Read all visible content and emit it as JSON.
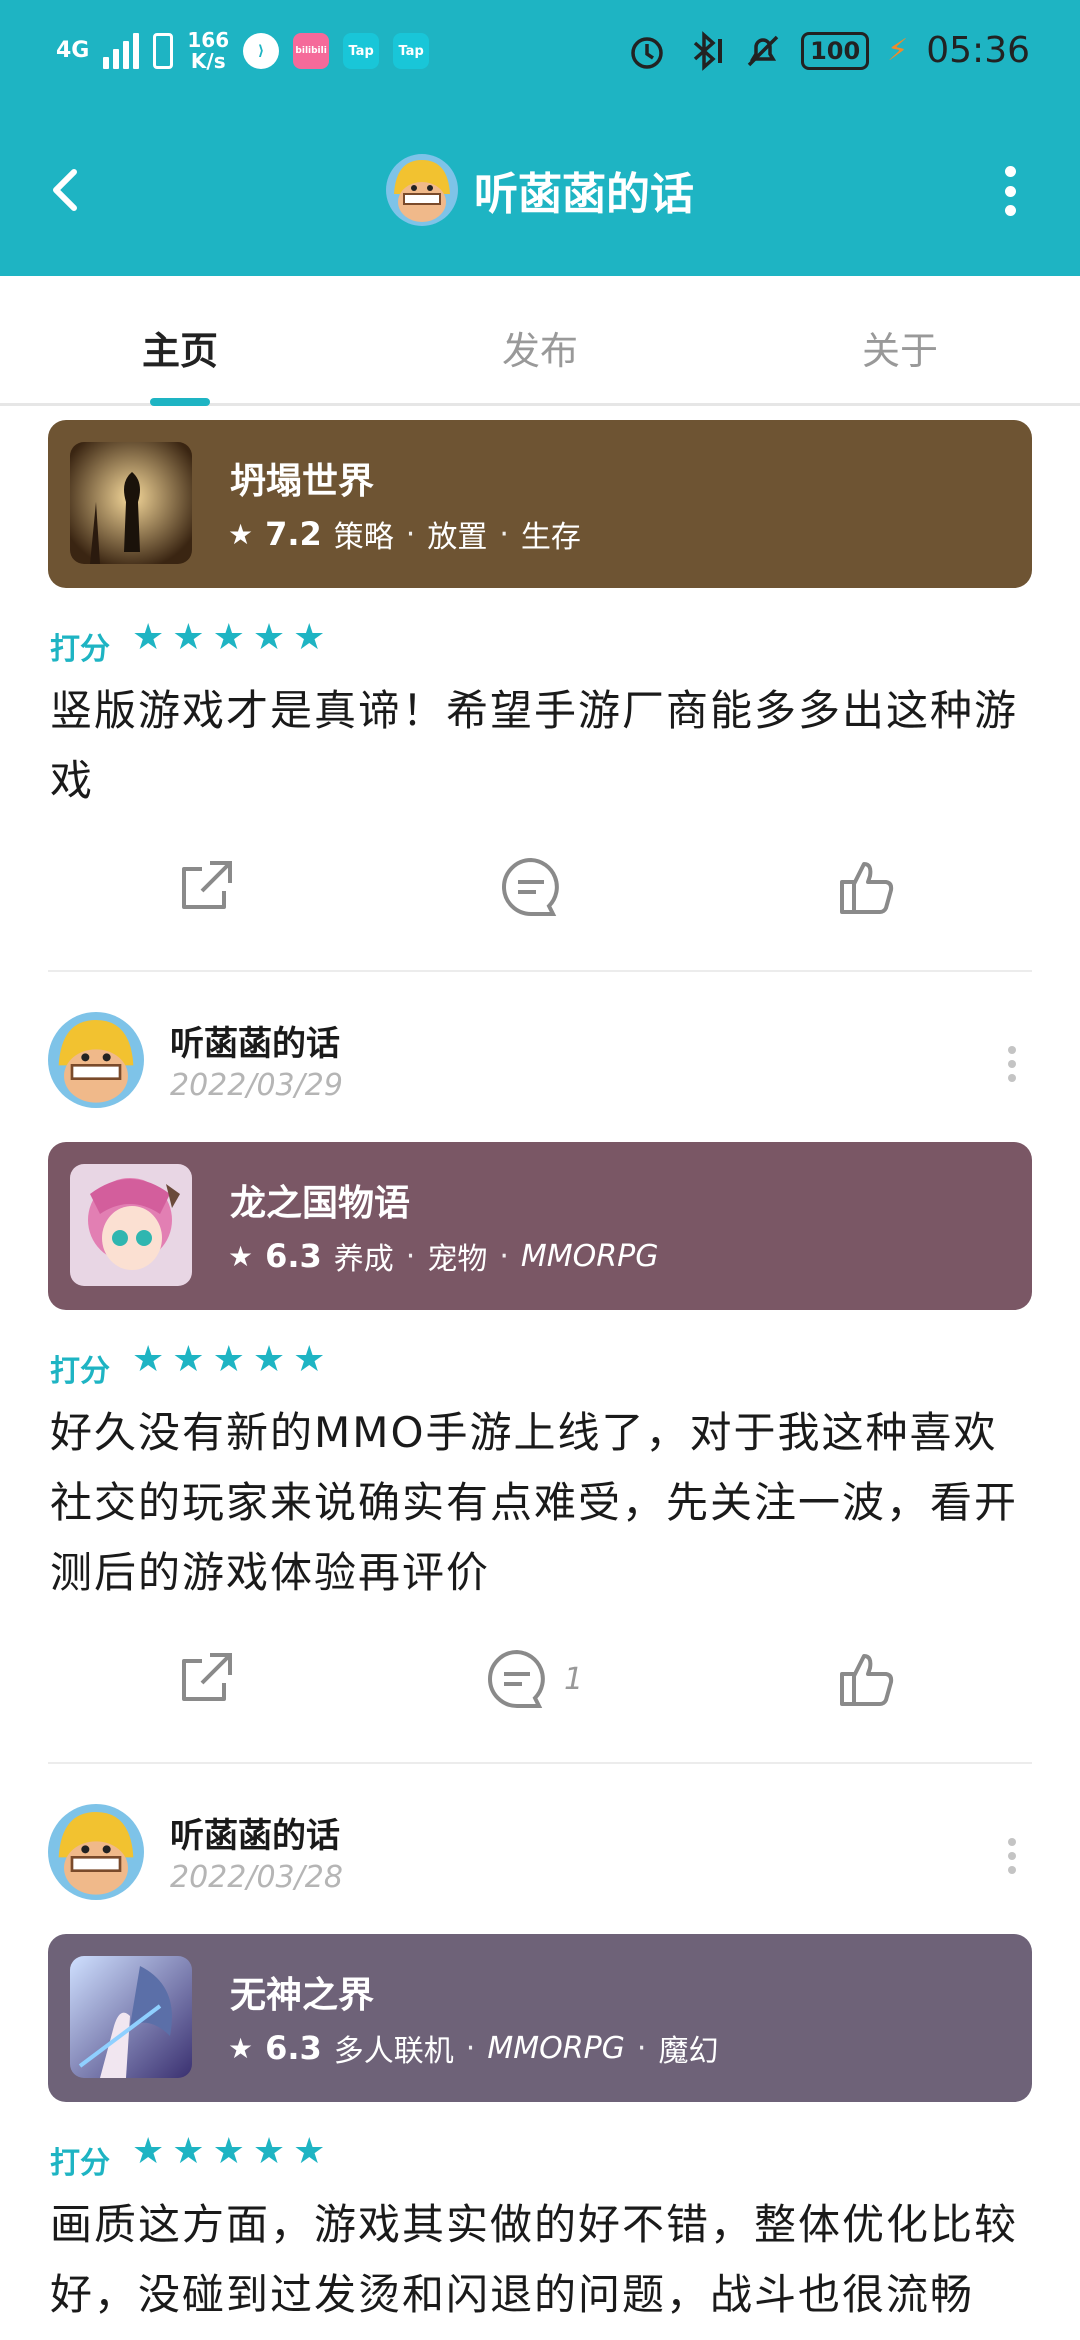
{
  "status_bar": {
    "network": "4G",
    "speed_value": "166",
    "speed_unit": "K/s",
    "app_badges": [
      "bilibili",
      "Tap",
      "Tap"
    ],
    "battery": "100",
    "time": "05:36"
  },
  "nav": {
    "title": "听菡菡的话"
  },
  "tabs": [
    {
      "label": "主页",
      "active": true
    },
    {
      "label": "发布",
      "active": false
    },
    {
      "label": "关于",
      "active": false
    }
  ],
  "posts": [
    {
      "game": {
        "name": "坍塌世界",
        "score": "7.2",
        "tags": [
          "策略",
          "放置",
          "生存"
        ],
        "card_color": "#6e5433"
      },
      "rating_label": "打分",
      "stars": 5,
      "review": "竖版游戏才是真谛！希望手游厂商能多多出这种游戏",
      "comment_count": ""
    },
    {
      "author": {
        "name": "听菡菡的话",
        "date": "2022/03/29"
      },
      "game": {
        "name": "龙之国物语",
        "score": "6.3",
        "tags": [
          "养成",
          "宠物",
          "MMORPG"
        ],
        "card_color": "#7a5765"
      },
      "rating_label": "打分",
      "stars": 5,
      "review": "好久没有新的MMO手游上线了，对于我这种喜欢社交的玩家来说确实有点难受，先关注一波，看开测后的游戏体验再评价",
      "comment_count": "1"
    },
    {
      "author": {
        "name": "听菡菡的话",
        "date": "2022/03/28"
      },
      "game": {
        "name": "无神之界",
        "score": "6.3",
        "tags": [
          "多人联机",
          "MMORPG",
          "魔幻"
        ],
        "card_color": "#6e6278"
      },
      "rating_label": "打分",
      "stars": 5,
      "review": "画质这方面，游戏其实做的好不错，整体优化比较好，没碰到过发烫和闪退的问题，战斗也很流畅",
      "comment_count": ""
    }
  ],
  "icons": {
    "back": "chevron-left-icon",
    "more": "more-vertical-icon",
    "share": "share-icon",
    "comment": "comment-icon",
    "like": "thumbs-up-icon",
    "star": "star-icon"
  },
  "colors": {
    "accent": "#1eb4c3"
  }
}
